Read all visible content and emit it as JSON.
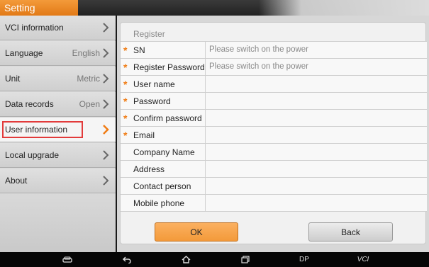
{
  "title": "Setting",
  "sidebar": {
    "items": [
      {
        "label": "VCI information",
        "value": ""
      },
      {
        "label": "Language",
        "value": "English"
      },
      {
        "label": "Unit",
        "value": "Metric"
      },
      {
        "label": "Data records",
        "value": "Open"
      },
      {
        "label": "User information",
        "value": ""
      },
      {
        "label": "Local upgrade",
        "value": ""
      },
      {
        "label": "About",
        "value": ""
      }
    ]
  },
  "register": {
    "title": "Register",
    "fields": [
      {
        "label": "SN",
        "required": true,
        "value": "Please switch on the power"
      },
      {
        "label": "Register Password",
        "required": true,
        "value": "Please switch on the power"
      },
      {
        "label": "User name",
        "required": true,
        "value": ""
      },
      {
        "label": "Password",
        "required": true,
        "value": ""
      },
      {
        "label": "Confirm password",
        "required": true,
        "value": ""
      },
      {
        "label": "Email",
        "required": true,
        "value": ""
      },
      {
        "label": "Company Name",
        "required": false,
        "value": ""
      },
      {
        "label": "Address",
        "required": false,
        "value": ""
      },
      {
        "label": "Contact person",
        "required": false,
        "value": ""
      },
      {
        "label": "Mobile phone",
        "required": false,
        "value": ""
      }
    ],
    "ok_label": "OK",
    "back_label": "Back"
  },
  "navbar": {
    "dp_label": "DP",
    "vci_label": "VCI"
  },
  "colors": {
    "accent": "#f39a3a",
    "required_marker": "#f07c14",
    "selection_outline": "#e23b3b"
  }
}
